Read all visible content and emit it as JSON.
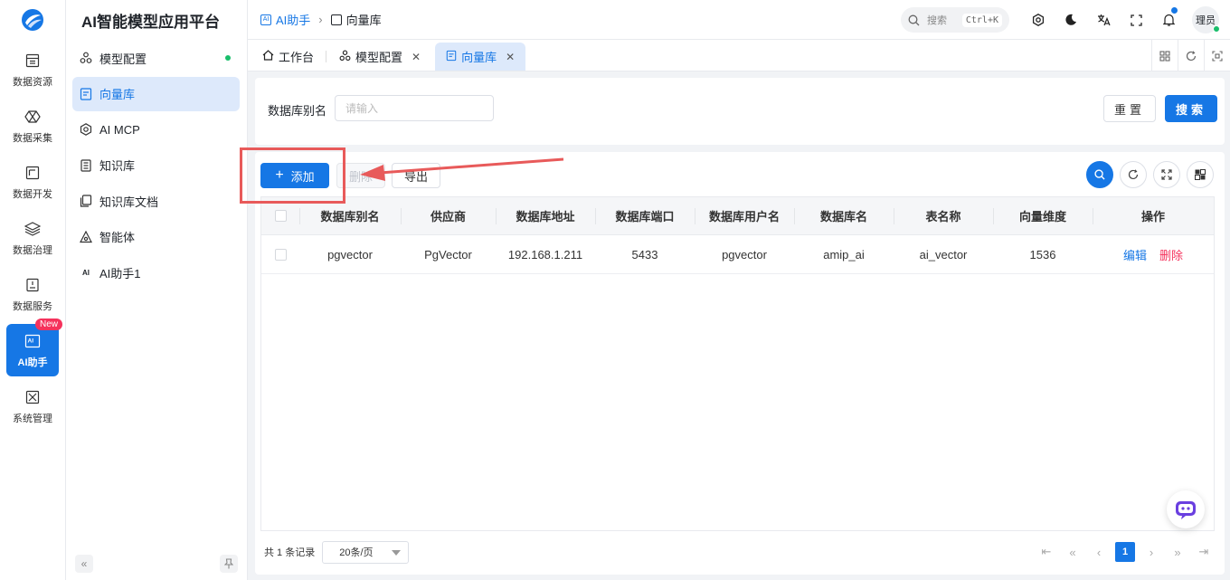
{
  "app": {
    "title": "AI智能模型应用平台"
  },
  "rail": {
    "items": [
      {
        "label": "数据资源",
        "icon": "database-icon"
      },
      {
        "label": "数据采集",
        "icon": "collect-icon"
      },
      {
        "label": "数据开发",
        "icon": "develop-icon"
      },
      {
        "label": "数据治理",
        "icon": "layers-icon"
      },
      {
        "label": "数据服务",
        "icon": "service-icon"
      },
      {
        "label": "AI助手",
        "icon": "ai-icon",
        "active": true,
        "badge": "New"
      },
      {
        "label": "系统管理",
        "icon": "system-icon"
      }
    ]
  },
  "sidebar": {
    "items": [
      {
        "label": "模型配置",
        "icon": "cluster-icon"
      },
      {
        "label": "向量库",
        "icon": "doc-icon",
        "active": true
      },
      {
        "label": "AI MCP",
        "icon": "mcp-icon"
      },
      {
        "label": "知识库",
        "icon": "book-icon"
      },
      {
        "label": "知识库文档",
        "icon": "files-icon"
      },
      {
        "label": "智能体",
        "icon": "agent-icon"
      },
      {
        "label": "AI助手1",
        "icon": "ai-text-icon"
      }
    ],
    "collapse_icon": "chevrons-left-icon",
    "pin_icon": "pin-icon"
  },
  "header": {
    "breadcrumb": [
      "AI助手",
      "向量库"
    ],
    "search_placeholder": "搜索",
    "search_shortcut": "Ctrl+K",
    "avatar_text": "理员"
  },
  "tabs": [
    {
      "label": "工作台",
      "icon": "home-icon"
    },
    {
      "label": "模型配置",
      "icon": "cluster-icon",
      "closable": true
    },
    {
      "label": "向量库",
      "icon": "doc-icon",
      "closable": true,
      "active": true
    }
  ],
  "search_form": {
    "label": "数据库别名",
    "placeholder": "请输入",
    "reset_label": "重置",
    "search_label": "搜索"
  },
  "toolbar": {
    "add_label": "添加",
    "delete_label": "删除",
    "export_label": "导出"
  },
  "table": {
    "columns": [
      "数据库别名",
      "供应商",
      "数据库地址",
      "数据库端口",
      "数据库用户名",
      "数据库名",
      "表名称",
      "向量维度",
      "操作"
    ],
    "rows": [
      {
        "alias": "pgvector",
        "vendor": "PgVector",
        "address": "192.168.1.211",
        "port": "5433",
        "username": "pgvector",
        "dbname": "amip_ai",
        "table": "ai_vector",
        "dimension": "1536",
        "edit": "编辑",
        "delete": "删除"
      }
    ]
  },
  "pagination": {
    "total_text": "共 1 条记录",
    "page_size": "20条/页",
    "current_page": "1"
  },
  "colors": {
    "primary": "#1677e5",
    "danger": "#f5325c",
    "annotation": "#e85a5a"
  }
}
